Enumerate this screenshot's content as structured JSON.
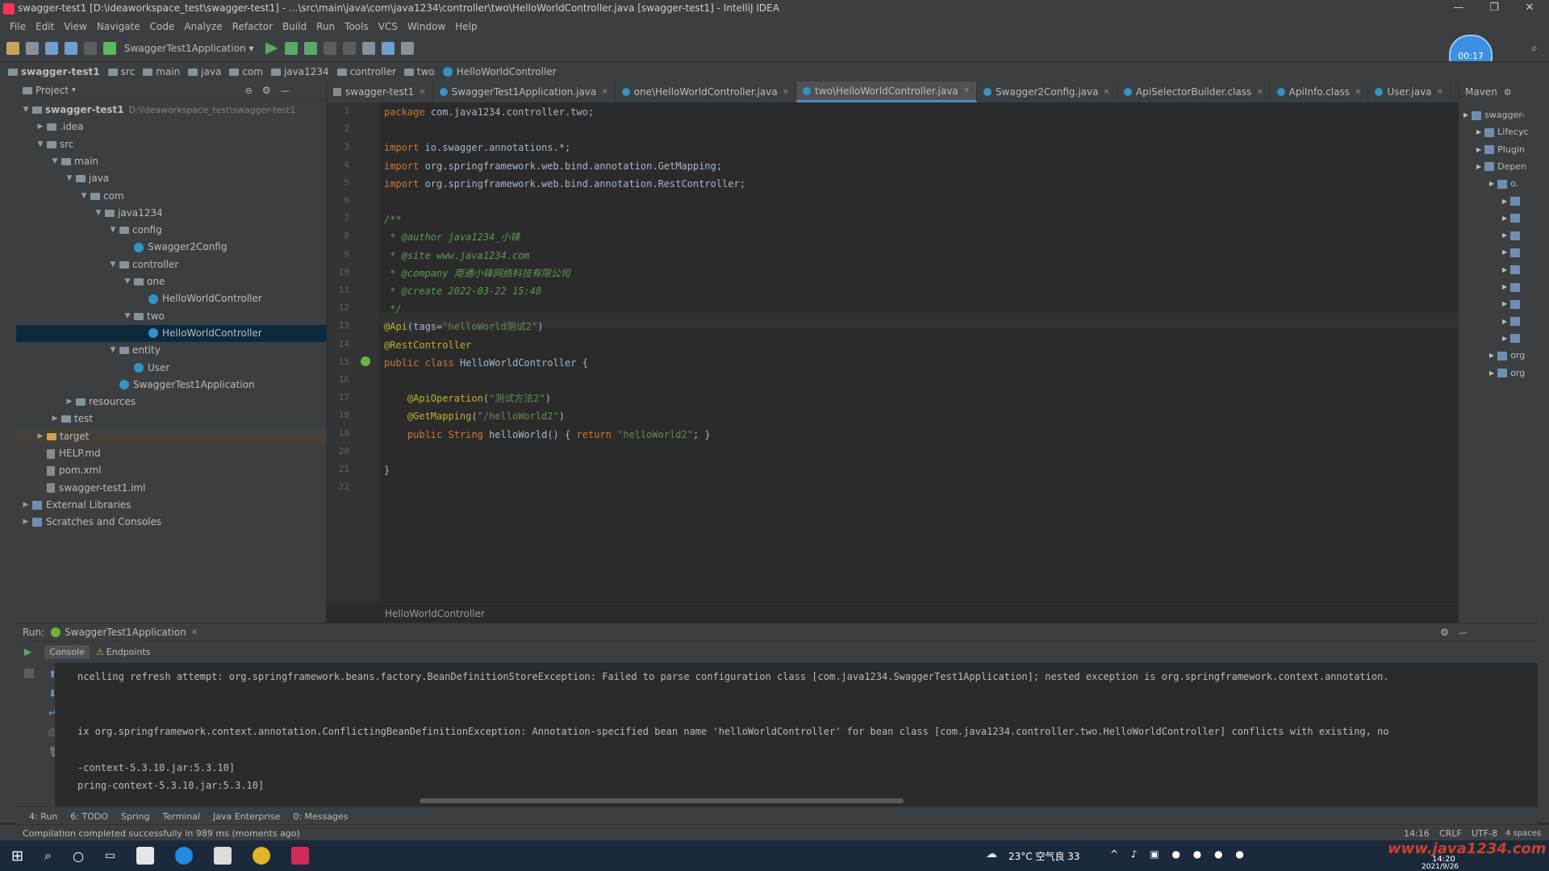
{
  "window": {
    "title": "swagger-test1 [D:\\ideaworkspace_test\\swagger-test1] - ...\\src\\main\\java\\com\\java1234\\controller\\two\\HelloWorldController.java [swagger-test1] - IntelliJ IDEA",
    "controls": [
      "—",
      "❐",
      "✕"
    ]
  },
  "menu": [
    "File",
    "Edit",
    "View",
    "Navigate",
    "Code",
    "Analyze",
    "Refactor",
    "Build",
    "Run",
    "Tools",
    "VCS",
    "Window",
    "Help"
  ],
  "toolbar": {
    "run_config": "SwaggerTest1Application",
    "timer_badge": "00:17"
  },
  "breadcrumbs": [
    "swagger-test1",
    "src",
    "main",
    "java",
    "com",
    "java1234",
    "controller",
    "two",
    "HelloWorldController"
  ],
  "project": {
    "header": "Project",
    "tree": [
      {
        "label": "swagger-test1",
        "extra": "D:\\ideaworkspace_test\\swagger-test1",
        "depth": 0,
        "kind": "module",
        "open": true
      },
      {
        "label": ".idea",
        "depth": 1,
        "kind": "folder",
        "open": false
      },
      {
        "label": "src",
        "depth": 1,
        "kind": "folder",
        "open": true
      },
      {
        "label": "main",
        "depth": 2,
        "kind": "folder",
        "open": true
      },
      {
        "label": "java",
        "depth": 3,
        "kind": "folder",
        "open": true
      },
      {
        "label": "com",
        "depth": 4,
        "kind": "folder",
        "open": true
      },
      {
        "label": "java1234",
        "depth": 5,
        "kind": "folder",
        "open": true
      },
      {
        "label": "config",
        "depth": 6,
        "kind": "folder",
        "open": true
      },
      {
        "label": "Swagger2Config",
        "depth": 7,
        "kind": "class"
      },
      {
        "label": "controller",
        "depth": 6,
        "kind": "folder",
        "open": true
      },
      {
        "label": "one",
        "depth": 7,
        "kind": "folder",
        "open": true
      },
      {
        "label": "HelloWorldController",
        "depth": 8,
        "kind": "class"
      },
      {
        "label": "two",
        "depth": 7,
        "kind": "folder",
        "open": true
      },
      {
        "label": "HelloWorldController",
        "depth": 8,
        "kind": "class",
        "selected": true
      },
      {
        "label": "entity",
        "depth": 6,
        "kind": "folder",
        "open": true
      },
      {
        "label": "User",
        "depth": 7,
        "kind": "class"
      },
      {
        "label": "SwaggerTest1Application",
        "depth": 6,
        "kind": "class"
      },
      {
        "label": "resources",
        "depth": 3,
        "kind": "folder",
        "open": false
      },
      {
        "label": "test",
        "depth": 2,
        "kind": "folder",
        "open": false
      },
      {
        "label": "target",
        "depth": 1,
        "kind": "folder",
        "open": false,
        "highlight": true
      },
      {
        "label": "HELP.md",
        "depth": 1,
        "kind": "file"
      },
      {
        "label": "pom.xml",
        "depth": 1,
        "kind": "file"
      },
      {
        "label": "swagger-test1.iml",
        "depth": 1,
        "kind": "file"
      },
      {
        "label": "External Libraries",
        "depth": 0,
        "kind": "lib",
        "open": false
      },
      {
        "label": "Scratches and Consoles",
        "depth": 0,
        "kind": "lib",
        "open": false
      }
    ]
  },
  "tabs": [
    {
      "label": "swagger-test1",
      "active": false
    },
    {
      "label": "SwaggerTest1Application.java",
      "active": false
    },
    {
      "label": "one\\HelloWorldController.java",
      "active": false
    },
    {
      "label": "two\\HelloWorldController.java",
      "active": true
    },
    {
      "label": "Swagger2Config.java",
      "active": false
    },
    {
      "label": "ApiSelectorBuilder.class",
      "active": false
    },
    {
      "label": "ApiInfo.class",
      "active": false
    },
    {
      "label": "User.java",
      "active": false
    }
  ],
  "maven": {
    "header": "Maven",
    "items": [
      {
        "label": "swagger-",
        "depth": 0
      },
      {
        "label": "Lifecyc",
        "depth": 1
      },
      {
        "label": "Plugin",
        "depth": 1
      },
      {
        "label": "Depen",
        "depth": 1
      },
      {
        "label": "o.",
        "depth": 2
      },
      {
        "label": "",
        "depth": 3
      },
      {
        "label": "",
        "depth": 3
      },
      {
        "label": "",
        "depth": 3
      },
      {
        "label": "",
        "depth": 3
      },
      {
        "label": "",
        "depth": 3
      },
      {
        "label": "",
        "depth": 3
      },
      {
        "label": "",
        "depth": 3
      },
      {
        "label": "",
        "depth": 3
      },
      {
        "label": "",
        "depth": 3
      },
      {
        "label": "org",
        "depth": 2
      },
      {
        "label": "org",
        "depth": 2
      }
    ]
  },
  "code": {
    "line_numbers": [
      "1",
      "2",
      "3",
      "4",
      "5",
      "6",
      "7",
      "8",
      "9",
      "10",
      "11",
      "12",
      "13",
      "14",
      "15",
      "16",
      "17",
      "18",
      "19",
      "20",
      "21",
      "22"
    ],
    "lines": [
      "package com.java1234.controller.two;",
      "",
      "import io.swagger.annotations.*;",
      "import org.springframework.web.bind.annotation.GetMapping;",
      "import org.springframework.web.bind.annotation.RestController;",
      "",
      "/**",
      " * @author java1234_小锋",
      " * @site www.java1234.com",
      " * @company 南通小锋网络科技有限公司",
      " * @create 2022-03-22 15:48",
      " */",
      "@Api(tags=\"helloWorld测试2\")",
      "@RestController",
      "public class HelloWorldController {",
      "",
      "    @ApiOperation(\"测试方法2\")",
      "    @GetMapping(\"/helloWorld2\")",
      "    public String helloWorld() { return \"helloWorld2\"; }",
      "",
      "}",
      ""
    ],
    "footer_crumb": "HelloWorldController"
  },
  "run": {
    "label": "Run:",
    "config": "SwaggerTest1Application",
    "subtabs": [
      "Console",
      "Endpoints"
    ],
    "console_lines": [
      "ncelling refresh attempt: org.springframework.beans.factory.BeanDefinitionStoreException: Failed to parse configuration class [com.java1234.SwaggerTest1Application]; nested exception is org.springframework.context.annotation.",
      "",
      "",
      "ix org.springframework.context.annotation.ConflictingBeanDefinitionException: Annotation-specified bean name 'helloWorldController' for bean class [com.java1234.controller.two.HelloWorldController] conflicts with existing, no",
      "",
      "-context-5.3.10.jar:5.3.10]",
      "pring-context-5.3.10.jar:5.3.10]"
    ]
  },
  "tool_tabs": [
    "4: Run",
    "6: TODO",
    "Spring",
    "Terminal",
    "Java Enterprise",
    "0: Messages"
  ],
  "status": {
    "message": "Compilation completed successfully in 989 ms (moments ago)",
    "right": [
      "14:16",
      "CRLF",
      "UTF-8",
      "4 spaces"
    ]
  },
  "taskbar": {
    "weather": "23°C 空气良 33",
    "time": "14:20",
    "date": "2021/9/26",
    "watermark": "www.java1234.com"
  },
  "colors": {
    "editor_bg": "#2b2b2b",
    "panel_bg": "#3c3f41",
    "selection": "#0d293e",
    "keyword": "#cc7832",
    "annotation": "#bbb529",
    "string": "#6a8759",
    "accent": "#4a88c7"
  }
}
